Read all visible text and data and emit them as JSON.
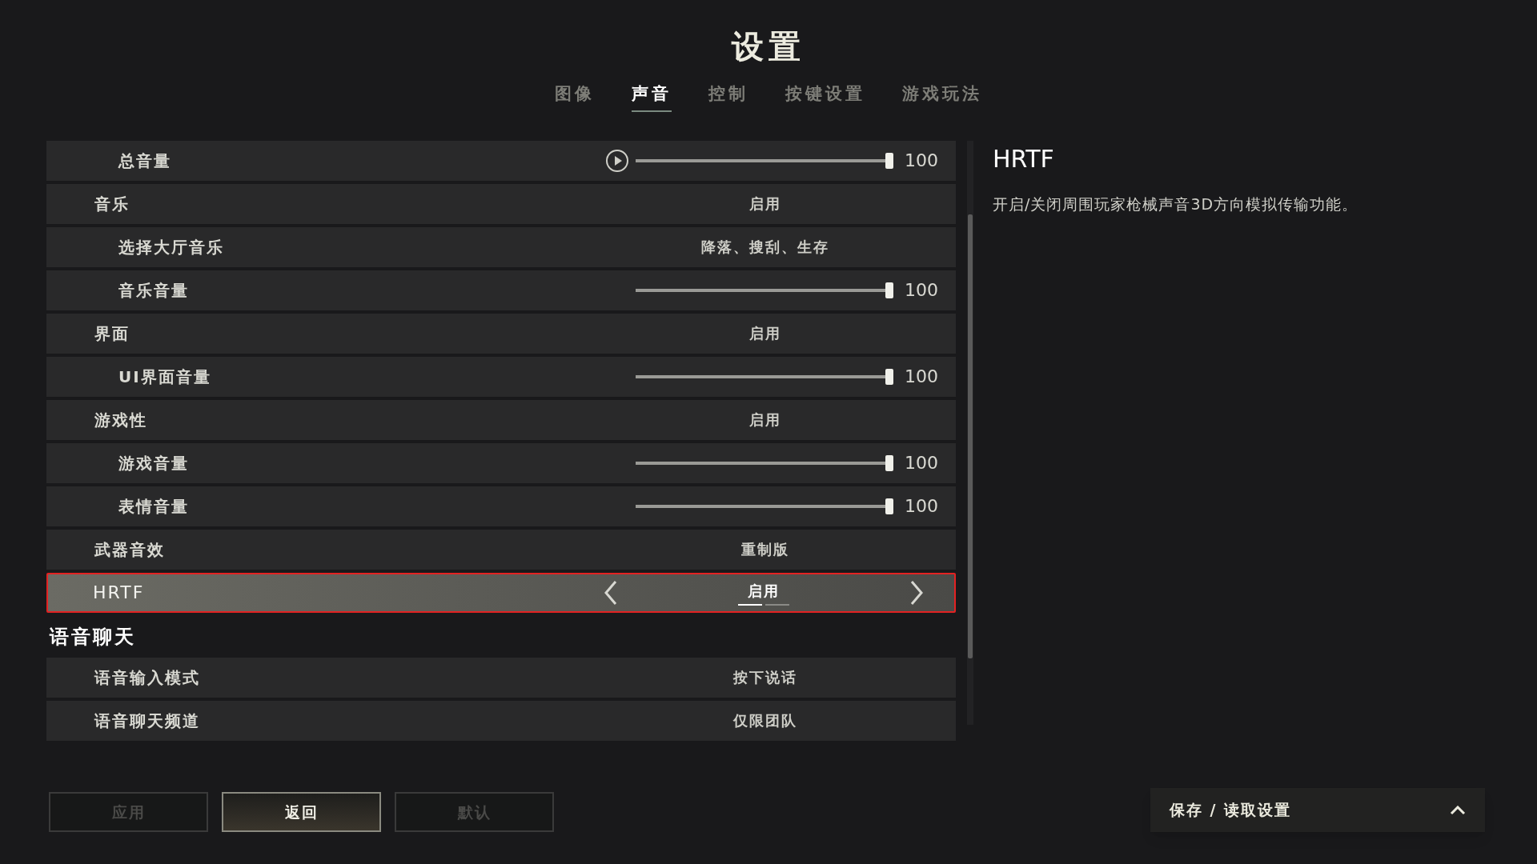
{
  "title": "设置",
  "tabs": [
    {
      "label": "图像",
      "selected": false
    },
    {
      "label": "声音",
      "selected": true
    },
    {
      "label": "控制",
      "selected": false
    },
    {
      "label": "按键设置",
      "selected": false
    },
    {
      "label": "游戏玩法",
      "selected": false
    }
  ],
  "sections": [
    {
      "items": [
        {
          "children": [
            {
              "kind": "slider",
              "label": "总音量",
              "preview": true,
              "level": 1,
              "reading": "100",
              "selected": false
            }
          ]
        },
        {
          "kind": "option",
          "label": "音乐",
          "value": "启用",
          "selected": false,
          "children": [
            {
              "kind": "option",
              "label": "选择大厅音乐",
              "value": "降落、搜刮、生存",
              "selected": false
            },
            {
              "kind": "slider",
              "label": "音乐音量",
              "preview": false,
              "level": 1,
              "reading": "100",
              "selected": false
            }
          ]
        },
        {
          "kind": "option",
          "label": "界面",
          "value": "启用",
          "selected": false,
          "children": [
            {
              "kind": "slider",
              "label": "UI界面音量",
              "preview": false,
              "level": 1,
              "reading": "100",
              "selected": false
            }
          ]
        },
        {
          "kind": "option",
          "label": "游戏性",
          "value": "启用",
          "selected": false,
          "children": [
            {
              "kind": "slider",
              "label": "游戏音量",
              "preview": false,
              "level": 1,
              "reading": "100",
              "selected": false
            },
            {
              "kind": "slider",
              "label": "表情音量",
              "preview": false,
              "level": 1,
              "reading": "100",
              "selected": false
            }
          ]
        },
        {
          "kind": "option",
          "label": "武器音效",
          "value": "重制版",
          "selected": false
        },
        {
          "kind": "option",
          "label": "HRTF",
          "value": "启用",
          "selected": true,
          "choices": [
            {
              "selected": true
            },
            {
              "selected": false
            }
          ]
        }
      ]
    },
    {
      "title": "语音聊天",
      "items": [
        {
          "kind": "option",
          "label": "语音输入模式",
          "value": "按下说话",
          "selected": false
        },
        {
          "kind": "option",
          "label": "语音聊天频道",
          "value": "仅限团队",
          "selected": false
        }
      ]
    }
  ],
  "detail": {
    "title": "HRTF",
    "description": "开启/关闭周围玩家枪械声音3D方向模拟传输功能。"
  },
  "buttons": [
    {
      "label": "应用",
      "disabled": true,
      "selected": false
    },
    {
      "label": "返回",
      "disabled": false,
      "selected": true
    },
    {
      "label": "默认",
      "disabled": true,
      "selected": false
    }
  ],
  "presets": {
    "label": "保存 / 读取设置",
    "expanded": false
  }
}
